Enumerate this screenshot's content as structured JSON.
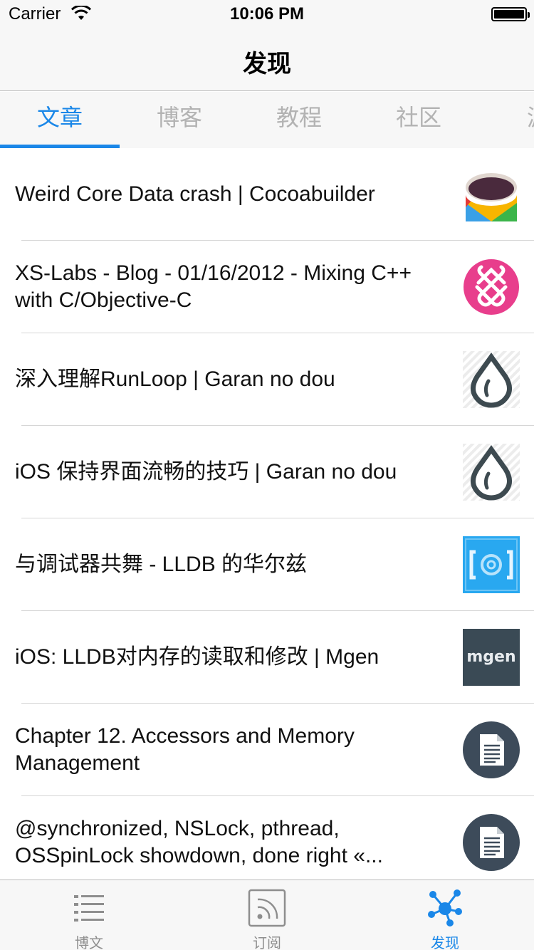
{
  "status_bar": {
    "carrier": "Carrier",
    "time": "10:06 PM"
  },
  "nav": {
    "title": "发现"
  },
  "segments": [
    {
      "label": "文章",
      "active": true
    },
    {
      "label": "博客",
      "active": false
    },
    {
      "label": "教程",
      "active": false
    },
    {
      "label": "社区",
      "active": false
    },
    {
      "label": "源",
      "active": false
    }
  ],
  "articles": [
    {
      "title": "Weird Core Data crash | Cocoabuilder",
      "icon": "cocoabuilder-icon"
    },
    {
      "title": "XS-Labs - Blog - 01/16/2012 - Mixing C++ with C/Objective-C",
      "icon": "xs-labs-icon"
    },
    {
      "title": "深入理解RunLoop | Garan no dou",
      "icon": "water-drop-icon"
    },
    {
      "title": "iOS 保持界面流畅的技巧 | Garan no dou",
      "icon": "water-drop-icon"
    },
    {
      "title": "与调试器共舞 - LLDB 的华尔兹",
      "icon": "at-bracket-icon"
    },
    {
      "title": "iOS: LLDB对内存的读取和修改 | Mgen",
      "icon": "mgen-logo-icon",
      "logo_text": "mgen"
    },
    {
      "title": "Chapter 12. Accessors and Memory Management",
      "icon": "document-icon"
    },
    {
      "title": "@synchronized, NSLock, pthread, OSSpinLock showdown, done right «...",
      "icon": "document-icon"
    }
  ],
  "tab_bar": [
    {
      "label": "博文",
      "icon": "list-icon",
      "active": false
    },
    {
      "label": "订阅",
      "icon": "rss-icon",
      "active": false
    },
    {
      "label": "发现",
      "icon": "network-icon",
      "active": true
    }
  ],
  "colors": {
    "accent": "#1a87e8",
    "inactive": "#b3b3b3",
    "tab_inactive": "#8e8e8e"
  }
}
